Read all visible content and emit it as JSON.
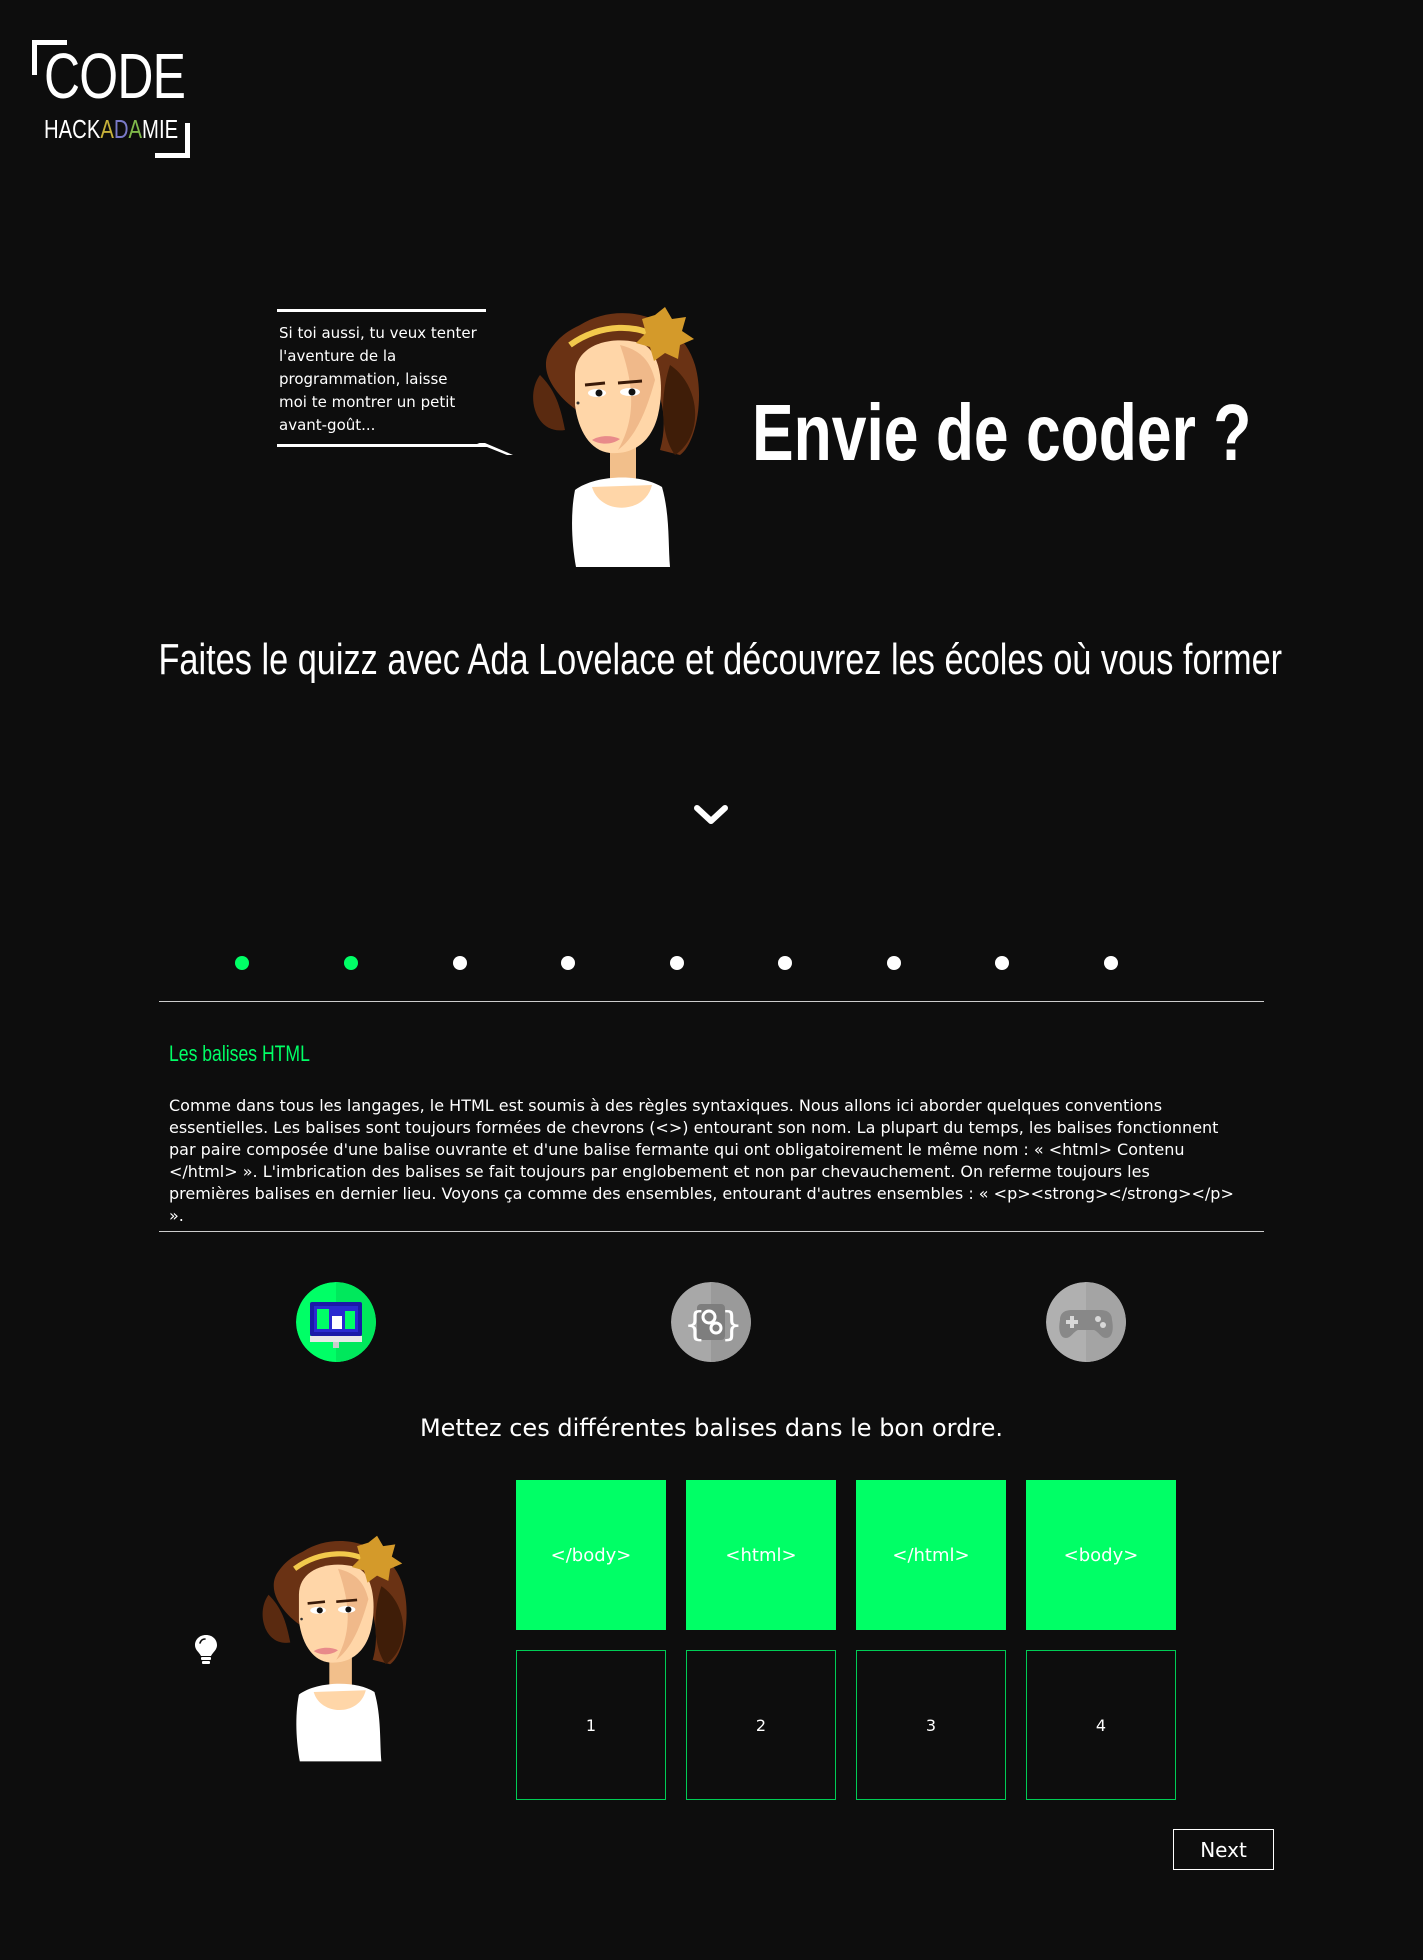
{
  "logo": {
    "word": "CODE",
    "sub_parts": [
      "HACK",
      "A",
      "D",
      "A",
      "MIE"
    ],
    "sub_colors": [
      "#ffffff",
      "#c7b23a",
      "#7a7ac8",
      "#7fb84a",
      "#ffffff"
    ]
  },
  "hero": {
    "bubble_text": "Si toi aussi, tu veux tenter l'aventure de la programmation, laisse moi te montrer un petit avant-goût...",
    "title": "Envie de coder ?",
    "subtitle": "Faites le quizz avec Ada Lovelace et découvrez les écoles où vous former"
  },
  "progress": {
    "total_steps": 9,
    "completed_steps": 2,
    "active_color": "#00ff66",
    "inactive_color": "#ffffff"
  },
  "lesson": {
    "title": "Les balises HTML",
    "body": "Comme dans tous les langages, le HTML est soumis à des règles syntaxiques. Nous allons ici aborder quelques conventions essentielles. Les balises sont toujours formées de chevrons (<>) entourant son nom. La plupart du temps, les balises fonctionnent par paire composée d'une balise ouvrante et d'une balise fermante qui ont obligatoirement le même nom : « <html> Contenu </html> ». L'imbrication des balises se fait toujours par englobement et non par chevauchement. On referme toujours les premières balises en dernier lieu. Voyons ça comme des ensembles, entourant d'autres ensembles : « <p><strong></strong></p> »."
  },
  "categories": [
    {
      "icon": "web-monitor-icon",
      "state": "active"
    },
    {
      "icon": "code-gear-icon",
      "state": "inactive"
    },
    {
      "icon": "gamepad-icon",
      "state": "inactive"
    }
  ],
  "quiz": {
    "instruction": "Mettez ces différentes balises dans le bon ordre.",
    "tiles": [
      "</body>",
      "<html>",
      "</html>",
      "<body>"
    ],
    "slots": [
      "1",
      "2",
      "3",
      "4"
    ],
    "hint_icon": "lightbulb-icon",
    "next_label": "Next"
  },
  "colors": {
    "background": "#0d0d0d",
    "accent": "#00ff66"
  }
}
